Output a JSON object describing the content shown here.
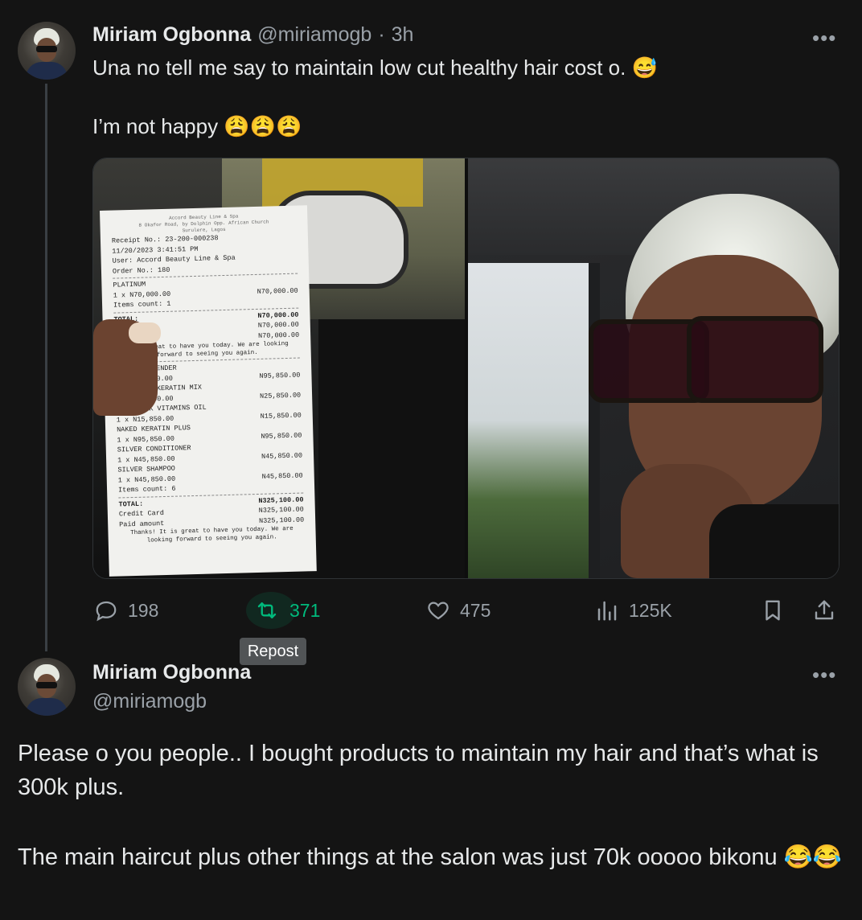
{
  "tweet1": {
    "display_name": "Miriam Ogbonna",
    "handle": "@miriamogb",
    "separator": "·",
    "time": "3h",
    "text_line1": "Una no tell me say to maintain low cut healthy hair cost o. 😅",
    "text_line2": "I’m not happy 😩😩😩",
    "more": "•••",
    "actions": {
      "replies": "198",
      "reposts": "371",
      "likes": "475",
      "views": "125K"
    },
    "tooltip": "Repost"
  },
  "receipt": {
    "header_lines": [
      "Accord Beauty Line & Spa",
      "8 Okafor Road, by Dolphin Opp. African Church",
      "Surulere, Lagos"
    ],
    "receipt_no": "Receipt No.: 23-200-000238",
    "date": "11/20/2023 3:41:51 PM",
    "user": "User: Accord Beauty Line & Spa",
    "order_no": "Order No.: 180",
    "items1": [
      {
        "name": "PLATINUM",
        "qty": "1 x N70,000.00",
        "price": "N70,000.00"
      }
    ],
    "items_count1": "Items count: 1",
    "total1_label": "TOTAL:",
    "total1": "N70,000.00",
    "sub1a": "N70,000.00",
    "sub1b": "N70,000.00",
    "thanks1": "It is great to have you today. We are looking forward to seeing you again.",
    "items2": [
      {
        "name": "ION HAIR MENDER",
        "qty": "1 x N25,850.00",
        "price": "N95,850.00"
      },
      {
        "name": "HAIR TALK KERATIN MIX",
        "qty": "1 x N25,850.00",
        "price": "N25,850.00"
      },
      {
        "name": "HAIR TALK VITAMINS OIL",
        "qty": "1 x N15,850.00",
        "price": "N15,850.00"
      },
      {
        "name": "NAKED KERATIN PLUS",
        "qty": "1 x N95,850.00",
        "price": "N95,850.00"
      },
      {
        "name": "SILVER CONDITIONER",
        "qty": "1 x N45,850.00",
        "price": "N45,850.00"
      },
      {
        "name": "SILVER SHAMPOO",
        "qty": "1 x N45,850.00",
        "price": "N45,850.00"
      }
    ],
    "items_count2": "Items count: 6",
    "total2_label": "TOTAL:",
    "total2": "N325,100.00",
    "credit_label": "Credit Card",
    "credit": "N325,100.00",
    "paid_label": "Paid amount",
    "paid": "N325,100.00",
    "thanks2": "Thanks! It is great to have you today. We are looking forward to seeing you again."
  },
  "tweet2": {
    "display_name": "Miriam Ogbonna",
    "handle": "@miriamogb",
    "more": "•••",
    "para1": "Please o you people.. I bought products to maintain my hair and that’s what is 300k plus.",
    "para2": "The main haircut plus other things at the salon was just 70k ooooo bikonu 😂😂"
  },
  "colors": {
    "background": "#141414",
    "text": "#e7e9ea",
    "muted": "#9aa1a8",
    "repost_accent": "#00ba7c"
  },
  "icons": [
    "reply-icon",
    "repost-icon",
    "like-icon",
    "views-icon",
    "bookmark-icon",
    "share-icon",
    "more-icon"
  ]
}
